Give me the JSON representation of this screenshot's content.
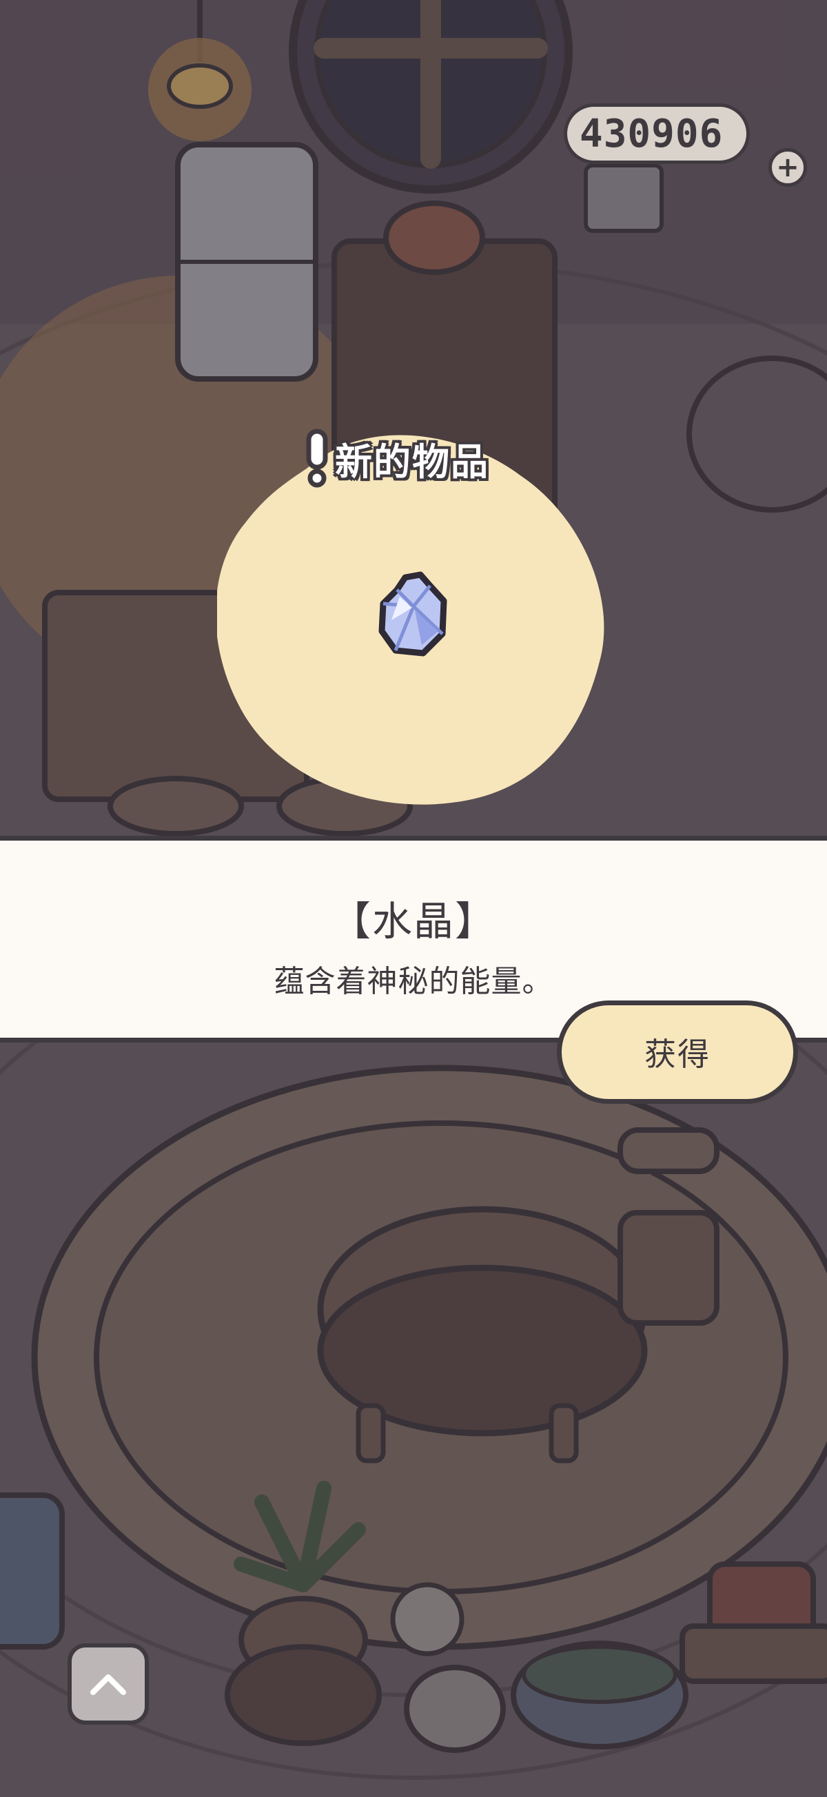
{
  "hud": {
    "coin_count": "430906",
    "add_icon": "plus-icon"
  },
  "popup": {
    "notice_label": "新的物品",
    "notice_icon": "exclamation-icon",
    "item_icon": "crystal-icon",
    "item_name": "【水晶】",
    "item_description": "蕴含着神秘的能量。",
    "confirm_label": "获得"
  },
  "controls": {
    "expand_icon": "chevron-up-icon"
  },
  "colors": {
    "outline": "#3f3a3f",
    "panel_bg": "#fdf9f4",
    "button_bg": "#f8e7bd",
    "highlight_blob": "#f7e6bb"
  }
}
